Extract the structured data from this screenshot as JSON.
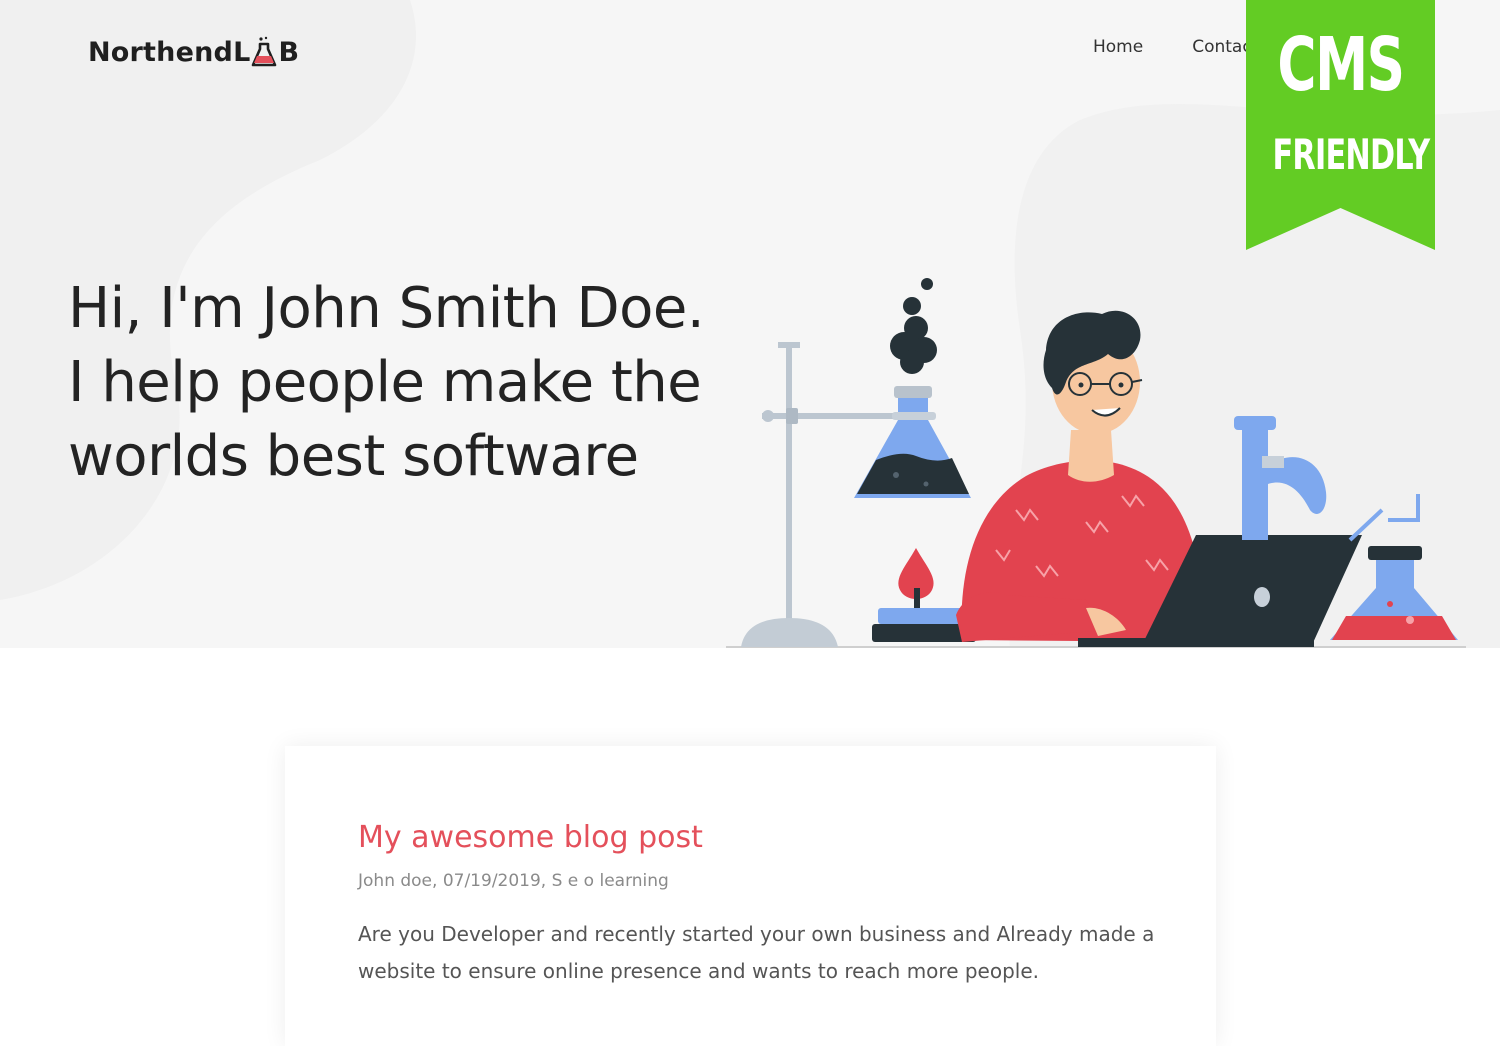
{
  "header": {
    "logo_text_left": "Northend",
    "logo_text_mid": "L",
    "logo_text_right": "B",
    "nav": [
      "Home",
      "Contact"
    ]
  },
  "hero": {
    "headline": [
      "Hi, I'm John Smith Doe.",
      "I help people make the",
      "worlds best software"
    ]
  },
  "badge": {
    "line1": "CMS",
    "line2": "FRIENDLY",
    "color": "#63cc24"
  },
  "post": {
    "title": "My awesome blog post",
    "meta": "John doe, 07/19/2019, S e o learning",
    "excerpt": "Are you Developer and recently started your own business and Already made a website to ensure online presence and wants to reach more people."
  },
  "colors": {
    "accent": "#e4505b",
    "hero_bg": "#f6f6f6",
    "sweater": "#e2434f",
    "glass": "#7ea8ee",
    "laptop": "#263238"
  }
}
